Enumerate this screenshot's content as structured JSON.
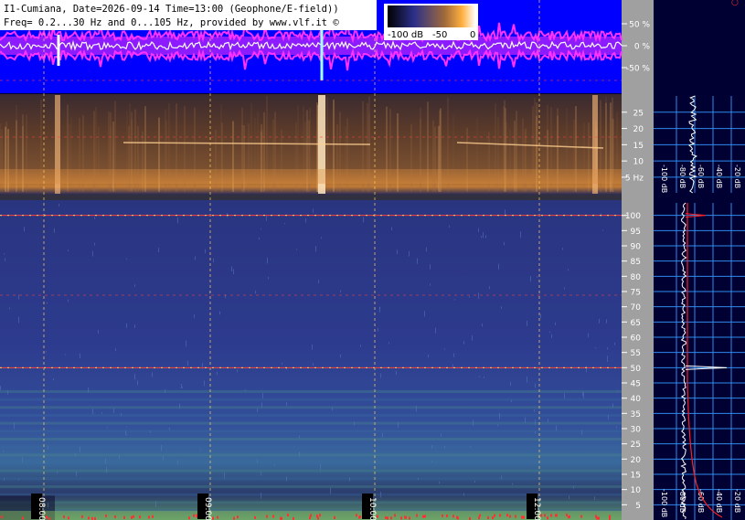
{
  "header": {
    "line1": "I1-Cumiana, Date=2026-09-14 Time=13:00 (Geophone/E-field))",
    "line2": "Freq= 0.2...30 Hz and 0...105 Hz, provided by www.vlf.it ©"
  },
  "colorbar": {
    "ticks": [
      "-100 dB",
      "-50",
      "0"
    ],
    "colors": [
      "#000000",
      "#2b2f8a",
      "#a06a3a",
      "#ffb040",
      "#ffffff"
    ]
  },
  "time_labels": [
    "08:00",
    "09:00",
    "10:00",
    "12:00"
  ],
  "colors": {
    "waveform_bg": "#0000ff",
    "waveform_envelope": "#ff33ff",
    "waveform_trace": "#ffffff",
    "grid_red": "#ff4040",
    "grid_yellow": "#ffd060",
    "side_bg": "#000033",
    "grid_cyan": "#3399ff",
    "axis_bg": "#a0a0a0",
    "spectrum_white": "#ffffff",
    "spectrum_red": "#ff2020"
  },
  "chart_data": [
    {
      "type": "line",
      "name": "waveform",
      "ylabel_ticks": [
        "50 %",
        "0 %",
        "-50 %"
      ],
      "ylim": [
        -100,
        100
      ]
    },
    {
      "type": "heatmap",
      "name": "low-frequency-spectrogram",
      "y_ticks": [
        "25",
        "20",
        "15",
        "10",
        "5 Hz"
      ],
      "ylim": [
        0.2,
        30
      ],
      "side_labels": [
        "-100 dB",
        "-80 dB",
        "-60 dB",
        "-40 dB",
        "-20 dB"
      ]
    },
    {
      "type": "heatmap",
      "name": "high-frequency-spectrogram",
      "y_ticks": [
        "100",
        "95",
        "90",
        "85",
        "80",
        "75",
        "70",
        "65",
        "60",
        "55",
        "50",
        "45",
        "40",
        "35",
        "30",
        "25",
        "20",
        "15",
        "10",
        "5"
      ],
      "ylim": [
        0,
        105
      ],
      "x_ticks": [
        "08:00",
        "09:00",
        "10:00",
        "12:00"
      ],
      "highlight_lines_hz": [
        50,
        100
      ],
      "side_labels": [
        "-100 dB",
        "-80 dB",
        "-60 dB",
        "-40 dB",
        "-20 dB"
      ]
    }
  ]
}
